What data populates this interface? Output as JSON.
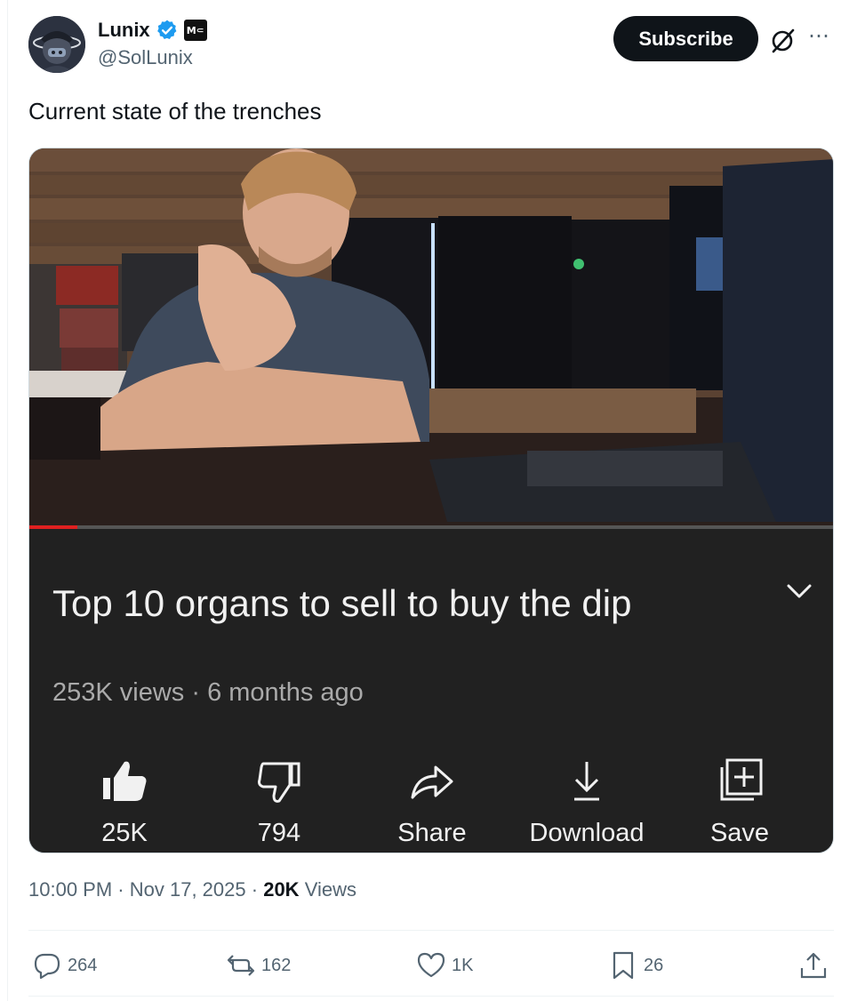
{
  "author": {
    "name": "Lunix",
    "handle": "@SolLunix",
    "badge_text": "M⸦"
  },
  "header": {
    "subscribe_label": "Subscribe"
  },
  "tweet": {
    "text": "Current state of the trenches",
    "time": "10:00 PM",
    "date": "Nov 17, 2025",
    "views_count": "20K",
    "views_label": "Views"
  },
  "video": {
    "title": "Top 10 organs to sell to buy the dip",
    "meta": "253K views · 6 months ago",
    "progress_fraction": 0.06,
    "actions": [
      {
        "label": "25K",
        "icon": "thumbs-up-icon"
      },
      {
        "label": "794",
        "icon": "thumbs-down-icon"
      },
      {
        "label": "Share",
        "icon": "share-arrow-icon"
      },
      {
        "label": "Download",
        "icon": "download-icon"
      },
      {
        "label": "Save",
        "icon": "save-playlist-icon"
      }
    ]
  },
  "engagement": {
    "replies": "264",
    "reposts": "162",
    "likes": "1K",
    "bookmarks": "26"
  },
  "colors": {
    "verified": "#1d9bf0",
    "text": "#0f1419",
    "muted": "#536471",
    "yt_bg": "#212121"
  }
}
